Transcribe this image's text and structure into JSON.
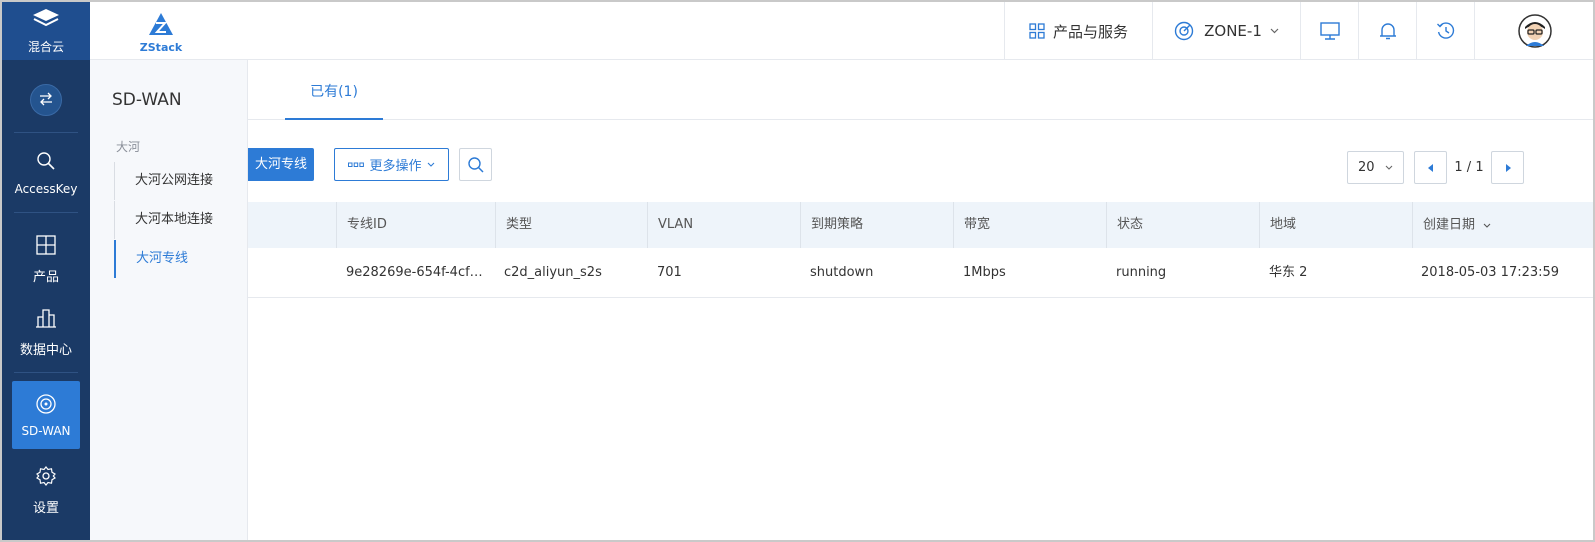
{
  "nav": {
    "top_label": "混合云",
    "items": [
      {
        "label": "AccessKey",
        "icon": "key-search-icon"
      },
      {
        "label": "产品",
        "icon": "grid-icon"
      },
      {
        "label": "数据中心",
        "icon": "building-icon"
      },
      {
        "label": "SD-WAN",
        "icon": "radar-icon"
      },
      {
        "label": "设置",
        "icon": "gear-icon"
      }
    ]
  },
  "header": {
    "logo_text": "ZStack",
    "products_label": "产品与服务",
    "zone_label": "ZONE-1"
  },
  "subnav": {
    "title": "SD-WAN",
    "group": "大河",
    "items": [
      "大河公网连接",
      "大河本地连接",
      "大河专线"
    ]
  },
  "main": {
    "tab_label": "已有(1)",
    "primary_button": "大河专线",
    "more_actions": "更多操作",
    "page_size": "20",
    "page_info": "1 / 1",
    "columns": [
      "专线ID",
      "类型",
      "VLAN",
      "到期策略",
      "带宽",
      "状态",
      "地域",
      "创建日期"
    ],
    "rows": [
      {
        "id": "9e28269e-654f-4cf…",
        "type": "c2d_aliyun_s2s",
        "vlan": "701",
        "policy": "shutdown",
        "bandwidth": "1Mbps",
        "status": "running",
        "region": "华东 2",
        "created": "2018-05-03 17:23:59"
      }
    ]
  },
  "colors": {
    "primary": "#2d7bd6",
    "nav_bg": "#1b3a66"
  }
}
